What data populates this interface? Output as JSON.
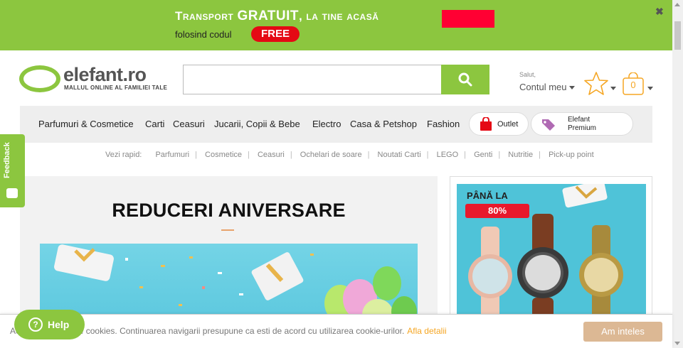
{
  "promo": {
    "line1_a": "Transport ",
    "line1_b": "GRATUIT",
    "line1_c": ", la tine acasă",
    "line2": "folosind codul",
    "code": "FREE",
    "close": "✖",
    "accent": "#8cc63f",
    "code_color": "#e50914"
  },
  "logo": {
    "name": "elefant.ro",
    "tagline": "MALLUL ONLINE AL FAMILIEI TALE"
  },
  "search": {
    "value": "",
    "placeholder": ""
  },
  "account": {
    "greeting": "Salut,",
    "label": "Contul meu"
  },
  "cart": {
    "count": "0"
  },
  "nav": {
    "categories": [
      "Parfumuri & Cosmetice",
      "Carti",
      "Ceasuri",
      "Jucarii, Copii & Bebe",
      "Electro",
      "Casa & Petshop",
      "Fashion"
    ],
    "outlet": "Outlet",
    "premium_line1": "Elefant",
    "premium_line2": "Premium"
  },
  "quick": {
    "label": "Vezi rapid:",
    "links": [
      "Parfumuri",
      "Cosmetice",
      "Ceasuri",
      "Ochelari de soare",
      "Noutati Carti",
      "LEGO",
      "Genti",
      "Nutritie",
      "Pick-up point"
    ]
  },
  "hero": {
    "title": "REDUCERI ANIVERSARE"
  },
  "side": {
    "top": "PÂNĂ LA",
    "badge": "80%"
  },
  "feedback": {
    "label": "Feedback"
  },
  "help": {
    "label": "Help"
  },
  "cookie": {
    "message": "Acest site foloseste cookies. Continuarea navigarii presupune ca esti de acord cu utilizarea cookie-urilor.",
    "link": "Afla detalii",
    "button": "Am inteles"
  }
}
